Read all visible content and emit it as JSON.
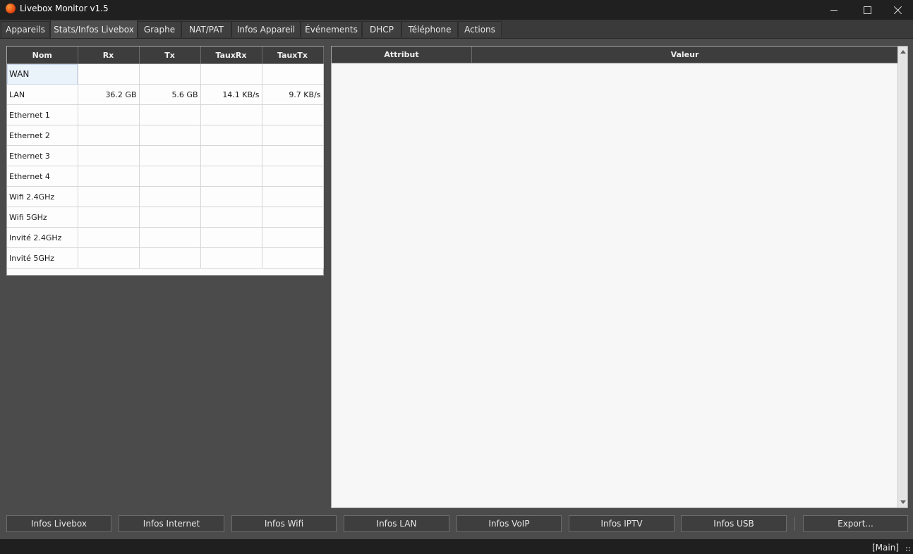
{
  "window": {
    "title": "Livebox Monitor v1.5"
  },
  "tabs": [
    {
      "label": "Appareils"
    },
    {
      "label": "Stats/Infos Livebox",
      "active": true
    },
    {
      "label": "Graphe"
    },
    {
      "label": "NAT/PAT"
    },
    {
      "label": "Infos Appareil"
    },
    {
      "label": "Événements"
    },
    {
      "label": "DHCP"
    },
    {
      "label": "Téléphone"
    },
    {
      "label": "Actions"
    }
  ],
  "stats_table": {
    "headers": [
      "Nom",
      "Rx",
      "Tx",
      "TauxRx",
      "TauxTx"
    ],
    "rows": [
      [
        "WAN",
        "",
        "",
        "",
        ""
      ],
      [
        "LAN",
        "36.2 GB",
        "5.6 GB",
        "14.1 KB/s",
        "9.7 KB/s"
      ],
      [
        "Ethernet 1",
        "",
        "",
        "",
        ""
      ],
      [
        "Ethernet 2",
        "",
        "",
        "",
        ""
      ],
      [
        "Ethernet 3",
        "",
        "",
        "",
        ""
      ],
      [
        "Ethernet 4",
        "",
        "",
        "",
        ""
      ],
      [
        "Wifi 2.4GHz",
        "",
        "",
        "",
        ""
      ],
      [
        "Wifi 5GHz",
        "",
        "",
        "",
        ""
      ],
      [
        "Invité 2.4GHz",
        "",
        "",
        "",
        ""
      ],
      [
        "Invité 5GHz",
        "",
        "",
        "",
        ""
      ]
    ]
  },
  "attr_table": {
    "headers": [
      "Attribut",
      "Valeur"
    ]
  },
  "buttons": [
    {
      "label": "Infos Livebox"
    },
    {
      "label": "Infos Internet"
    },
    {
      "label": "Infos Wifi"
    },
    {
      "label": "Infos LAN"
    },
    {
      "label": "Infos VoIP"
    },
    {
      "label": "Infos IPTV"
    },
    {
      "label": "Infos USB"
    },
    {
      "label": "Export..."
    }
  ],
  "status": {
    "text": "[Main]"
  },
  "colors": {
    "app_icon": "#e85a1a",
    "background": "#4b4b4b",
    "header": "#3d3d3d"
  }
}
